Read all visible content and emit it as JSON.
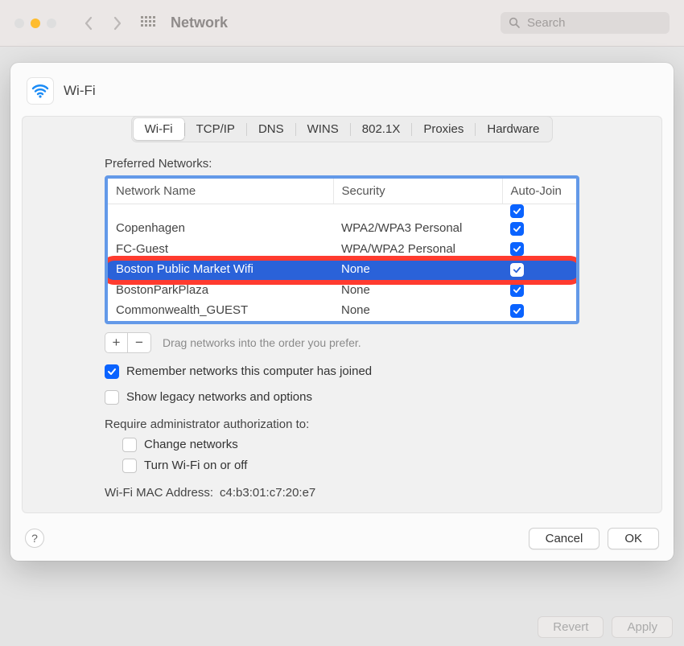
{
  "toolbar": {
    "title": "Network",
    "search_placeholder": "Search"
  },
  "sheet": {
    "title": "Wi-Fi"
  },
  "tabs": [
    "Wi-Fi",
    "TCP/IP",
    "DNS",
    "WINS",
    "802.1X",
    "Proxies",
    "Hardware"
  ],
  "active_tab": 0,
  "preferred_label": "Preferred Networks:",
  "columns": {
    "name": "Network Name",
    "security": "Security",
    "autojoin": "Auto-Join"
  },
  "networks": [
    {
      "name": "Copenhagen",
      "security": "WPA2/WPA3 Personal",
      "autojoin": true,
      "selected": false
    },
    {
      "name": "FC-Guest",
      "security": "WPA/WPA2 Personal",
      "autojoin": true,
      "selected": false
    },
    {
      "name": "Boston Public Market Wifi",
      "security": "None",
      "autojoin": true,
      "selected": true
    },
    {
      "name": "BostonParkPlaza",
      "security": "None",
      "autojoin": true,
      "selected": false
    },
    {
      "name": "Commonwealth_GUEST",
      "security": "None",
      "autojoin": true,
      "selected": false
    }
  ],
  "drag_hint": "Drag networks into the order you prefer.",
  "remember_label": "Remember networks this computer has joined",
  "remember_checked": true,
  "legacy_label": "Show legacy networks and options",
  "legacy_checked": false,
  "admin_label": "Require administrator authorization to:",
  "admin_change_label": "Change networks",
  "admin_change_checked": false,
  "admin_wifi_label": "Turn Wi-Fi on or off",
  "admin_wifi_checked": false,
  "mac_label": "Wi-Fi MAC Address:",
  "mac_value": "c4:b3:01:c7:20:e7",
  "buttons": {
    "help": "?",
    "cancel": "Cancel",
    "ok": "OK",
    "revert": "Revert",
    "apply": "Apply"
  }
}
